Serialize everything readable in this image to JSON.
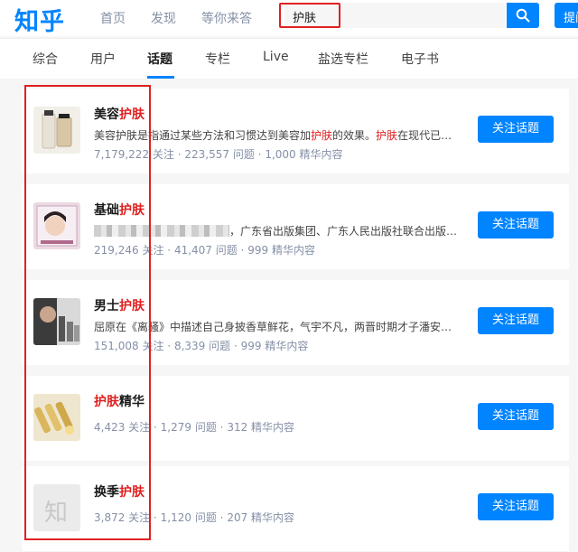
{
  "header": {
    "logo": "知乎",
    "nav": [
      "首页",
      "发现",
      "等你来答"
    ],
    "search_value": "护肤",
    "ask_label": "提问"
  },
  "tabs": [
    "综合",
    "用户",
    "话题",
    "专栏",
    "Live",
    "盐选专栏",
    "电子书"
  ],
  "active_tab": "话题",
  "colors": {
    "accent": "#0084ff",
    "highlight": "#e02020"
  },
  "topics": [
    {
      "title_pre": "美容",
      "title_hl": "护肤",
      "title_post": "",
      "desc": [
        {
          "t": "美容护肤是指通过某些方法和习惯达到美容加",
          "hl": false
        },
        {
          "t": "护肤",
          "hl": true
        },
        {
          "t": "的效果。",
          "hl": false
        },
        {
          "t": "护肤",
          "hl": true
        },
        {
          "t": "在现代已…",
          "hl": false
        }
      ],
      "followers": "7,179,222 关注",
      "questions": "223,557 问题",
      "essence": "1,000 精华内容",
      "button": "关注话题"
    },
    {
      "title_pre": "基础",
      "title_hl": "护肤",
      "title_post": "",
      "desc": [
        {
          "t": "，广东省出版集团、广东人民出版社联合出版…",
          "hl": false
        }
      ],
      "followers": "219,246 关注",
      "questions": "41,407 问题",
      "essence": "999 精华内容",
      "button": "关注话题"
    },
    {
      "title_pre": "男士",
      "title_hl": "护肤",
      "title_post": "",
      "desc": [
        {
          "t": "屈原在《离骚》中描述自己身披香草鲜花，气宇不凡，两晋时期才子潘安…",
          "hl": false
        }
      ],
      "followers": "151,008 关注",
      "questions": "8,339 问题",
      "essence": "999 精华内容",
      "button": "关注话题"
    },
    {
      "title_pre": "",
      "title_hl": "护肤",
      "title_post": "精华",
      "desc": [],
      "followers": "4,423 关注",
      "questions": "1,279 问题",
      "essence": "312 精华内容",
      "button": "关注话题"
    },
    {
      "title_pre": "换季",
      "title_hl": "护肤",
      "title_post": "",
      "desc": [],
      "followers": "3,872 关注",
      "questions": "1,120 问题",
      "essence": "207 精华内容",
      "button": "关注话题",
      "placeholder_char": "知"
    }
  ],
  "separator": "·"
}
